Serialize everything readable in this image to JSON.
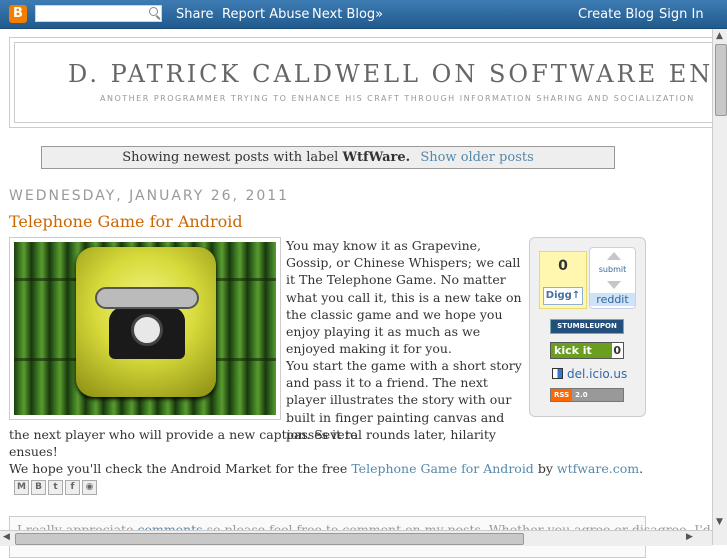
{
  "navbar": {
    "logo_letter": "B",
    "search_placeholder": "",
    "share": "Share",
    "report_abuse": "Report Abuse",
    "next_blog": "Next Blog»",
    "create_blog": "Create Blog",
    "sign_in": "Sign In"
  },
  "header": {
    "title": "D. PATRICK CALDWELL ON SOFTWARE ENGI",
    "description": "ANOTHER PROGRAMMER TRYING TO ENHANCE HIS CRAFT THROUGH INFORMATION SHARING AND SOCIALIZATION"
  },
  "status": {
    "prefix": "Showing newest posts with label",
    "label": "WtfWare.",
    "older": "Show older posts"
  },
  "post": {
    "date": "WEDNESDAY, JANUARY 26, 2011",
    "title": "Telephone Game for Android",
    "para1": "You may know it as Grapevine, Gossip, or Chinese Whispers; we call it The Telephone Game. No matter what you call it, this is a new take on the classic game and we hope you enjoy playing it as much as we enjoyed making it for you.",
    "para2_a": "You start the game with a short story and pass it to a friend. The next player illustrates the story with our built in finger painting canvas and passes it to",
    "para2_b": "the next player who will provide a new caption. Several rounds later, hilarity ensues!",
    "para3_prefix": "We hope you'll check the Android Market for the free",
    "para3_link": "Telephone Game for Android",
    "para3_by": "by",
    "para3_link2": "wtfware.com",
    "para3_end": "."
  },
  "social": {
    "digg_count": "0",
    "digg_label": "Digg",
    "reddit_submit": "submit",
    "reddit_name": "reddit",
    "stumble": "STUMBLEUPON",
    "kickit_label": "kick it",
    "kickit_count": "0",
    "delicious": "del.icio.us",
    "rss_a": "RSS",
    "rss_b": "2.0"
  },
  "share_icons": [
    "email-icon",
    "blog-this-icon",
    "twitter-icon",
    "facebook-icon",
    "buzz-icon"
  ],
  "comments": {
    "prefix": "I really appreciate",
    "link": "comments",
    "rest": "so please feel free to comment on my posts. Whether you agree or disagree, I'd"
  }
}
